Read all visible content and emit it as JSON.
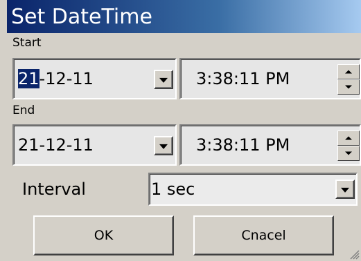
{
  "window": {
    "title": "Set DateTime"
  },
  "start": {
    "label": "Start",
    "date_selected": "21",
    "date_rest": "-12-11",
    "time": "3:38:11 PM"
  },
  "end": {
    "label": "End",
    "date": "21-12-11",
    "time": "3:38:11 PM"
  },
  "interval": {
    "label": "Interval",
    "value": "1 sec"
  },
  "buttons": {
    "ok": "OK",
    "cancel": "Cnacel"
  },
  "icons": {
    "dropdown": "chevron-down-icon",
    "spin_up": "spin-up-icon",
    "spin_down": "spin-down-icon",
    "resize": "resize-grip-icon"
  },
  "colors": {
    "title_start": "#0a246a",
    "title_end": "#a6caf0",
    "face": "#d4d0c8",
    "field": "#e6e6e6",
    "selection": "#0a246a"
  }
}
